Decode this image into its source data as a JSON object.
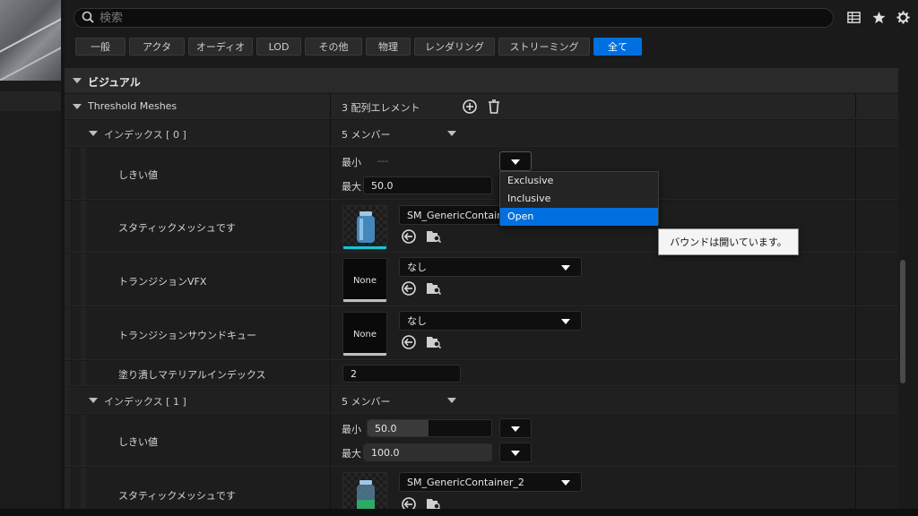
{
  "search": {
    "placeholder": "検索"
  },
  "filters": [
    {
      "label": "一般",
      "active": false
    },
    {
      "label": "アクタ",
      "active": false
    },
    {
      "label": "オーディオ",
      "active": false
    },
    {
      "label": "LOD",
      "active": false
    },
    {
      "label": "その他",
      "active": false
    },
    {
      "label": "物理",
      "active": false
    },
    {
      "label": "レンダリング",
      "active": false
    },
    {
      "label": "ストリーミング",
      "active": false
    },
    {
      "label": "全て",
      "active": true
    }
  ],
  "icons": {
    "search": "search-icon",
    "table_view": "table-icon",
    "favorites": "star-icon",
    "settings": "gear-icon",
    "add": "plus-circle-icon",
    "delete": "trash-icon",
    "reset": "arrow-left-circle-icon",
    "browse": "folder-search-icon"
  },
  "category": {
    "label": "ビジュアル"
  },
  "threshold": {
    "label": "Threshold Meshes",
    "value": "3 配列エレメント"
  },
  "index0": {
    "label": "インデックス [ 0 ]",
    "members": "5 メンバー",
    "threshold_label": "しきい値",
    "min_label": "最小",
    "min_value": "---",
    "max_label": "最大",
    "max_value": "50.0",
    "mesh_label": "スタティックメッシュです",
    "mesh_value": "SM_GenericContainer",
    "vfx_label": "トランジションVFX",
    "vfx_value": "なし",
    "vfx_thumb": "None",
    "sound_label": "トランジションサウンドキュー",
    "sound_value": "なし",
    "sound_thumb": "None",
    "fill_label": "塗り潰しマテリアルインデックス",
    "fill_value": "2"
  },
  "index1": {
    "label": "インデックス [ 1 ]",
    "members": "5 メンバー",
    "threshold_label": "しきい値",
    "min_label": "最小",
    "min_value": "50.0",
    "max_label": "最大",
    "max_value": "100.0",
    "mesh_label": "スタティックメッシュです",
    "mesh_value": "SM_GenericContainer_2"
  },
  "popup": {
    "options": [
      "Exclusive",
      "Inclusive",
      "Open"
    ],
    "selected": "Open",
    "tooltip": "バウンドは開いています。"
  },
  "colors": {
    "accent": "#0070e0",
    "selected_thumb": "#16c6d6"
  }
}
